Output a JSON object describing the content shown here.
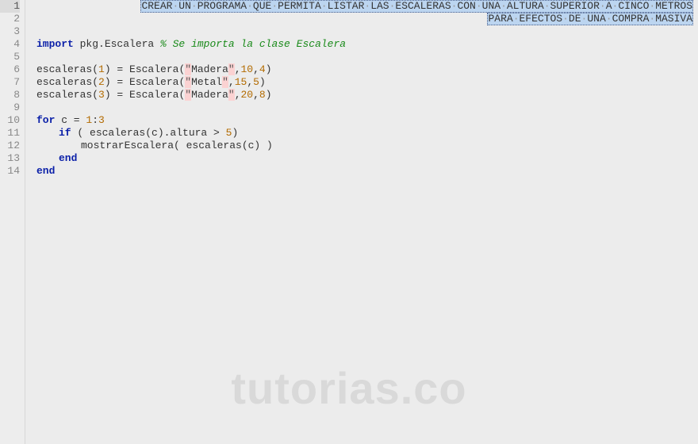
{
  "watermark": "tutorias.co",
  "gutter": [
    "1",
    "2",
    "3",
    "4",
    "5",
    "6",
    "7",
    "8",
    "9",
    "10",
    "11",
    "12",
    "13",
    "14"
  ],
  "comment_header_l1_words": [
    "CREAR",
    "UN",
    "PROGRAMA",
    "QUE",
    "PERMITA",
    "LISTAR",
    "LAS",
    "ESCALERAS",
    "CON",
    "UNA",
    "ALTURA",
    "SUPERIOR",
    "A",
    "CINCO",
    "METROS"
  ],
  "comment_header_l2_words": [
    "PARA",
    "EFECTOS",
    "DE",
    "UNA",
    "COMPRA",
    "MASIVA"
  ],
  "line4": {
    "kw": "import",
    "mod": " pkg.Escalera ",
    "cmt": "% Se importa la clase Escalera"
  },
  "line6": {
    "pre": "escaleras(",
    "idx": "1",
    "mid": ") = Escalera(",
    "q1": "\"",
    "str": "Madera",
    "q2": "\"",
    "c1": ",",
    "n1": "10",
    "c2": ",",
    "n2": "4",
    "end": ")"
  },
  "line7": {
    "pre": "escaleras(",
    "idx": "2",
    "mid": ") = Escalera(",
    "q1": "\"",
    "str": "Metal",
    "q2": "\"",
    "c1": ",",
    "n1": "15",
    "c2": ",",
    "n2": "5",
    "end": ")"
  },
  "line8": {
    "pre": "escaleras(",
    "idx": "3",
    "mid": ") = Escalera(",
    "q1": "\"",
    "str": "Madera",
    "q2": "\"",
    "c1": ",",
    "n1": "20",
    "c2": ",",
    "n2": "8",
    "end": ")"
  },
  "line10": {
    "kw": "for",
    "rest": " c = ",
    "n1": "1",
    "colon": ":",
    "n2": "3"
  },
  "line11": {
    "kw": "if",
    "rest1": " ( escaleras(c).altura > ",
    "n": "5",
    "rest2": ")"
  },
  "line12": {
    "call": "mostrarEscalera( escaleras(c) )"
  },
  "line13": {
    "kw": "end"
  },
  "line14": {
    "kw": "end"
  }
}
